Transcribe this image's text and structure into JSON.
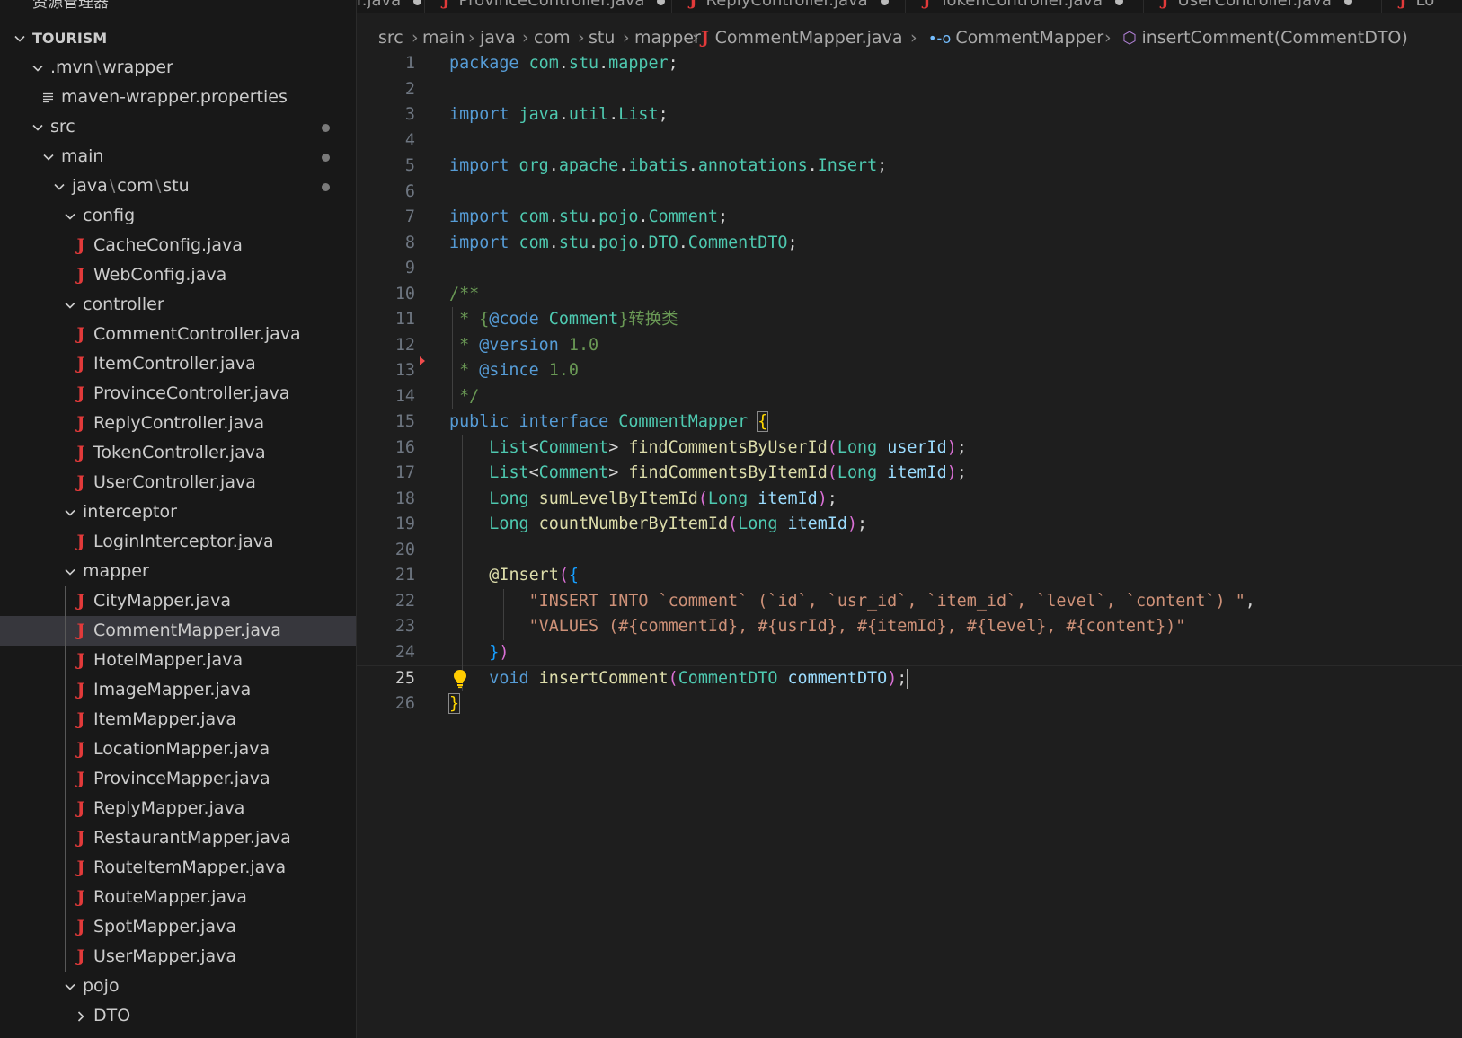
{
  "explorer": {
    "title": "资源管理器",
    "more": "···",
    "root": "TOURISM",
    "items": [
      {
        "label": "TOURISM",
        "type": "root",
        "depth": 0,
        "expanded": true
      },
      {
        "label_parts": [
          ".mvn",
          "wrapper"
        ],
        "type": "folder",
        "depth": 1,
        "expanded": true
      },
      {
        "label": "maven-wrapper.properties",
        "type": "props",
        "depth": 2
      },
      {
        "label": "src",
        "type": "folder",
        "depth": 1,
        "expanded": true,
        "modified": true
      },
      {
        "label": "main",
        "type": "folder",
        "depth": 2,
        "expanded": true,
        "modified": true
      },
      {
        "label_parts": [
          "java",
          "com",
          "stu"
        ],
        "type": "folder",
        "depth": 3,
        "expanded": true,
        "modified": true
      },
      {
        "label": "config",
        "type": "folder",
        "depth": 4,
        "expanded": true
      },
      {
        "label": "CacheConfig.java",
        "type": "java",
        "depth": 5
      },
      {
        "label": "WebConfig.java",
        "type": "java",
        "depth": 5
      },
      {
        "label": "controller",
        "type": "folder",
        "depth": 4,
        "expanded": true
      },
      {
        "label": "CommentController.java",
        "type": "java",
        "depth": 5
      },
      {
        "label": "ItemController.java",
        "type": "java",
        "depth": 5
      },
      {
        "label": "ProvinceController.java",
        "type": "java",
        "depth": 5
      },
      {
        "label": "ReplyController.java",
        "type": "java",
        "depth": 5
      },
      {
        "label": "TokenController.java",
        "type": "java",
        "depth": 5
      },
      {
        "label": "UserController.java",
        "type": "java",
        "depth": 5
      },
      {
        "label": "interceptor",
        "type": "folder",
        "depth": 4,
        "expanded": true
      },
      {
        "label": "LoginInterceptor.java",
        "type": "java",
        "depth": 5
      },
      {
        "label": "mapper",
        "type": "folder",
        "depth": 4,
        "expanded": true
      },
      {
        "label": "CityMapper.java",
        "type": "java",
        "depth": 5
      },
      {
        "label": "CommentMapper.java",
        "type": "java",
        "depth": 5,
        "selected": true
      },
      {
        "label": "HotelMapper.java",
        "type": "java",
        "depth": 5
      },
      {
        "label": "ImageMapper.java",
        "type": "java",
        "depth": 5
      },
      {
        "label": "ItemMapper.java",
        "type": "java",
        "depth": 5
      },
      {
        "label": "LocationMapper.java",
        "type": "java",
        "depth": 5
      },
      {
        "label": "ProvinceMapper.java",
        "type": "java",
        "depth": 5
      },
      {
        "label": "ReplyMapper.java",
        "type": "java",
        "depth": 5
      },
      {
        "label": "RestaurantMapper.java",
        "type": "java",
        "depth": 5
      },
      {
        "label": "RouteItemMapper.java",
        "type": "java",
        "depth": 5
      },
      {
        "label": "RouteMapper.java",
        "type": "java",
        "depth": 5
      },
      {
        "label": "SpotMapper.java",
        "type": "java",
        "depth": 5
      },
      {
        "label": "UserMapper.java",
        "type": "java",
        "depth": 5
      },
      {
        "label": "pojo",
        "type": "folder",
        "depth": 4,
        "expanded": true
      },
      {
        "label": "DTO",
        "type": "folder",
        "depth": 5,
        "expanded": false
      }
    ]
  },
  "tabs": [
    {
      "label": "r.java",
      "icon": false,
      "dirty": true
    },
    {
      "label": "ProvinceController.java",
      "icon": true,
      "dirty": true
    },
    {
      "label": "ReplyController.java",
      "icon": true,
      "dirty": true
    },
    {
      "label": "TokenController.java",
      "icon": true,
      "dirty": true
    },
    {
      "label": "UserController.java",
      "icon": true,
      "dirty": true
    },
    {
      "label": "Lo",
      "icon": true,
      "dirty": false
    }
  ],
  "breadcrumb": [
    "src",
    "main",
    "java",
    "com",
    "stu",
    "mapper",
    "CommentMapper.java",
    "CommentMapper",
    "insertComment(CommentDTO)"
  ],
  "editor": {
    "current_line": 25,
    "lines": [
      {
        "n": "1",
        "tokens": [
          [
            "k1",
            "package "
          ],
          [
            "ty",
            "com"
          ],
          [
            "pu",
            "."
          ],
          [
            "ty",
            "stu"
          ],
          [
            "pu",
            "."
          ],
          [
            "ty",
            "mapper"
          ],
          [
            "pu",
            ";"
          ]
        ]
      },
      {
        "n": "2",
        "tokens": []
      },
      {
        "n": "3",
        "tokens": [
          [
            "k1",
            "import "
          ],
          [
            "ty",
            "java"
          ],
          [
            "pu",
            "."
          ],
          [
            "ty",
            "util"
          ],
          [
            "pu",
            "."
          ],
          [
            "ty",
            "List"
          ],
          [
            "pu",
            ";"
          ]
        ]
      },
      {
        "n": "4",
        "tokens": []
      },
      {
        "n": "5",
        "tokens": [
          [
            "k1",
            "import "
          ],
          [
            "ty",
            "org"
          ],
          [
            "pu",
            "."
          ],
          [
            "ty",
            "apache"
          ],
          [
            "pu",
            "."
          ],
          [
            "ty",
            "ibatis"
          ],
          [
            "pu",
            "."
          ],
          [
            "ty",
            "annotations"
          ],
          [
            "pu",
            "."
          ],
          [
            "ty",
            "Insert"
          ],
          [
            "pu",
            ";"
          ]
        ]
      },
      {
        "n": "6",
        "tokens": []
      },
      {
        "n": "7",
        "tokens": [
          [
            "k1",
            "import "
          ],
          [
            "ty",
            "com"
          ],
          [
            "pu",
            "."
          ],
          [
            "ty",
            "stu"
          ],
          [
            "pu",
            "."
          ],
          [
            "ty",
            "pojo"
          ],
          [
            "pu",
            "."
          ],
          [
            "ty",
            "Comment"
          ],
          [
            "pu",
            ";"
          ]
        ]
      },
      {
        "n": "8",
        "tokens": [
          [
            "k1",
            "import "
          ],
          [
            "ty",
            "com"
          ],
          [
            "pu",
            "."
          ],
          [
            "ty",
            "stu"
          ],
          [
            "pu",
            "."
          ],
          [
            "ty",
            "pojo"
          ],
          [
            "pu",
            "."
          ],
          [
            "ty",
            "DTO"
          ],
          [
            "pu",
            "."
          ],
          [
            "ty",
            "CommentDTO"
          ],
          [
            "pu",
            ";"
          ]
        ]
      },
      {
        "n": "9",
        "tokens": []
      },
      {
        "n": "10",
        "tokens": [
          [
            "cm",
            "/**"
          ]
        ]
      },
      {
        "n": "11",
        "tokens": [
          [
            "cm",
            " * {"
          ],
          [
            "k1",
            "@code"
          ],
          [
            "cmt",
            " Comment"
          ],
          [
            "cm",
            "}转换类"
          ]
        ]
      },
      {
        "n": "12",
        "tokens": [
          [
            "cm",
            " * "
          ],
          [
            "k1",
            "@version"
          ],
          [
            "cm",
            " 1.0"
          ]
        ]
      },
      {
        "n": "13",
        "tokens": [
          [
            "cm",
            " * "
          ],
          [
            "k1",
            "@since"
          ],
          [
            "cm",
            " 1.0"
          ]
        ]
      },
      {
        "n": "14",
        "tokens": [
          [
            "cm",
            " */"
          ]
        ]
      },
      {
        "n": "15",
        "tokens": [
          [
            "k1",
            "public "
          ],
          [
            "k1",
            "interface "
          ],
          [
            "ty",
            "CommentMapper "
          ],
          [
            "b1 bmatch",
            "{"
          ]
        ]
      },
      {
        "n": "16",
        "tokens": [
          [
            "pu",
            "    "
          ],
          [
            "ty",
            "List"
          ],
          [
            "pu",
            "<"
          ],
          [
            "ty",
            "Comment"
          ],
          [
            "pu",
            "> "
          ],
          [
            "fn",
            "findCommentsByUserId"
          ],
          [
            "b2",
            "("
          ],
          [
            "ty",
            "Long "
          ],
          [
            "pm",
            "userId"
          ],
          [
            "b2",
            ")"
          ],
          [
            "pu",
            ";"
          ]
        ]
      },
      {
        "n": "17",
        "tokens": [
          [
            "pu",
            "    "
          ],
          [
            "ty",
            "List"
          ],
          [
            "pu",
            "<"
          ],
          [
            "ty",
            "Comment"
          ],
          [
            "pu",
            "> "
          ],
          [
            "fn",
            "findCommentsByItemId"
          ],
          [
            "b2",
            "("
          ],
          [
            "ty",
            "Long "
          ],
          [
            "pm",
            "itemId"
          ],
          [
            "b2",
            ")"
          ],
          [
            "pu",
            ";"
          ]
        ]
      },
      {
        "n": "18",
        "tokens": [
          [
            "pu",
            "    "
          ],
          [
            "ty",
            "Long "
          ],
          [
            "fn",
            "sumLevelByItemId"
          ],
          [
            "b2",
            "("
          ],
          [
            "ty",
            "Long "
          ],
          [
            "pm",
            "itemId"
          ],
          [
            "b2",
            ")"
          ],
          [
            "pu",
            ";"
          ]
        ]
      },
      {
        "n": "19",
        "tokens": [
          [
            "pu",
            "    "
          ],
          [
            "ty",
            "Long "
          ],
          [
            "fn",
            "countNumberByItemId"
          ],
          [
            "b2",
            "("
          ],
          [
            "ty",
            "Long "
          ],
          [
            "pm",
            "itemId"
          ],
          [
            "b2",
            ")"
          ],
          [
            "pu",
            ";"
          ]
        ]
      },
      {
        "n": "20",
        "tokens": []
      },
      {
        "n": "21",
        "tokens": [
          [
            "pu",
            "    "
          ],
          [
            "an",
            "@Insert"
          ],
          [
            "b2",
            "("
          ],
          [
            "b3",
            "{"
          ]
        ]
      },
      {
        "n": "22",
        "tokens": [
          [
            "pu",
            "        "
          ],
          [
            "st",
            "\"INSERT INTO `comment` (`id`, `usr_id`, `item_id`, `level`, `content`) \""
          ],
          [
            "pu",
            ","
          ]
        ]
      },
      {
        "n": "23",
        "tokens": [
          [
            "pu",
            "        "
          ],
          [
            "st",
            "\"VALUES (#{commentId}, #{usrId}, #{itemId}, #{level}, #{content})\""
          ]
        ]
      },
      {
        "n": "24",
        "tokens": [
          [
            "pu",
            "    "
          ],
          [
            "b3",
            "}"
          ],
          [
            "b2",
            ")"
          ]
        ]
      },
      {
        "n": "25",
        "tokens": [
          [
            "pu",
            "    "
          ],
          [
            "k1",
            "void "
          ],
          [
            "fn",
            "insertComment"
          ],
          [
            "b2",
            "("
          ],
          [
            "ty",
            "CommentDTO "
          ],
          [
            "pm",
            "commentDTO"
          ],
          [
            "b2",
            ")"
          ],
          [
            "pu",
            ";"
          ]
        ],
        "cursor": true
      },
      {
        "n": "26",
        "tokens": [
          [
            "b1 bmatch",
            "}"
          ]
        ]
      }
    ]
  }
}
